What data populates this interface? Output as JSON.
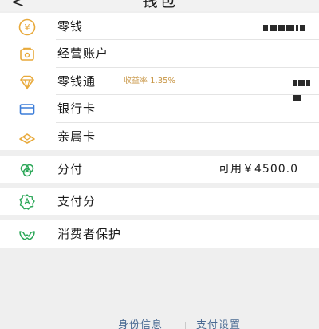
{
  "header": {
    "title": "钱包",
    "back_glyph": "<"
  },
  "rows": [
    {
      "label": "零钱",
      "icon": "coin-yen-icon"
    },
    {
      "label": "经营账户",
      "icon": "business-account-icon"
    },
    {
      "label": "零钱通",
      "icon": "diamond-icon",
      "rate": "收益率 1.35%"
    },
    {
      "label": "银行卡",
      "icon": "bank-card-icon"
    },
    {
      "label": "亲属卡",
      "icon": "family-card-icon"
    }
  ],
  "fenfu": {
    "label": "分付",
    "icon": "fenfu-icon",
    "available": "可用￥4500.0"
  },
  "score": {
    "label": "支付分",
    "icon": "payment-score-icon"
  },
  "protect": {
    "label": "消费者保护",
    "icon": "consumer-protection-icon"
  },
  "footer": {
    "identity": "身份信息",
    "settings": "支付设置"
  },
  "colors": {
    "accent_orange": "#e8a93a",
    "accent_green": "#2ea85a",
    "accent_blue": "#3c7dd9",
    "rate_text": "#c89645",
    "link": "#4a6a93"
  }
}
